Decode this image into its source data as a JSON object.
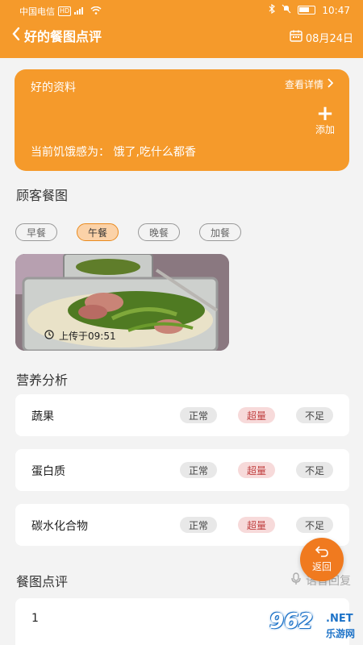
{
  "status_bar": {
    "carrier": "中国电信",
    "hd": "HD",
    "time": "10:47"
  },
  "nav": {
    "title": "好的餐图点评",
    "date": "08月24日"
  },
  "profile": {
    "title": "好的资料",
    "detail_link": "查看详情",
    "add_label": "添加",
    "hunger_text": "当前饥饿感为：  饿了,吃什么都香"
  },
  "meals": {
    "section_title": "顾客餐图",
    "tabs": [
      {
        "label": "早餐",
        "active": false
      },
      {
        "label": "午餐",
        "active": true
      },
      {
        "label": "晚餐",
        "active": false
      },
      {
        "label": "加餐",
        "active": false
      }
    ],
    "photo_caption": "上传于09:51"
  },
  "nutrition": {
    "section_title": "营养分析",
    "rows": [
      {
        "name": "蔬果",
        "normal": "正常",
        "over": "超量",
        "low": "不足"
      },
      {
        "name": "蛋白质",
        "normal": "正常",
        "over": "超量",
        "low": "不足"
      },
      {
        "name": "碳水化合物",
        "normal": "正常",
        "over": "超量",
        "low": "不足"
      }
    ]
  },
  "review": {
    "section_title": "餐图点评",
    "voice_reply": "语音回复",
    "comment_value": "1"
  },
  "fab": {
    "label": "返回"
  },
  "watermark": {
    "number": "962",
    "suffix": ".NET",
    "site": "乐游网"
  },
  "colors": {
    "brand_orange": "#f59a2b",
    "fab_orange": "#f07a1f",
    "over_red": "#c04040"
  }
}
